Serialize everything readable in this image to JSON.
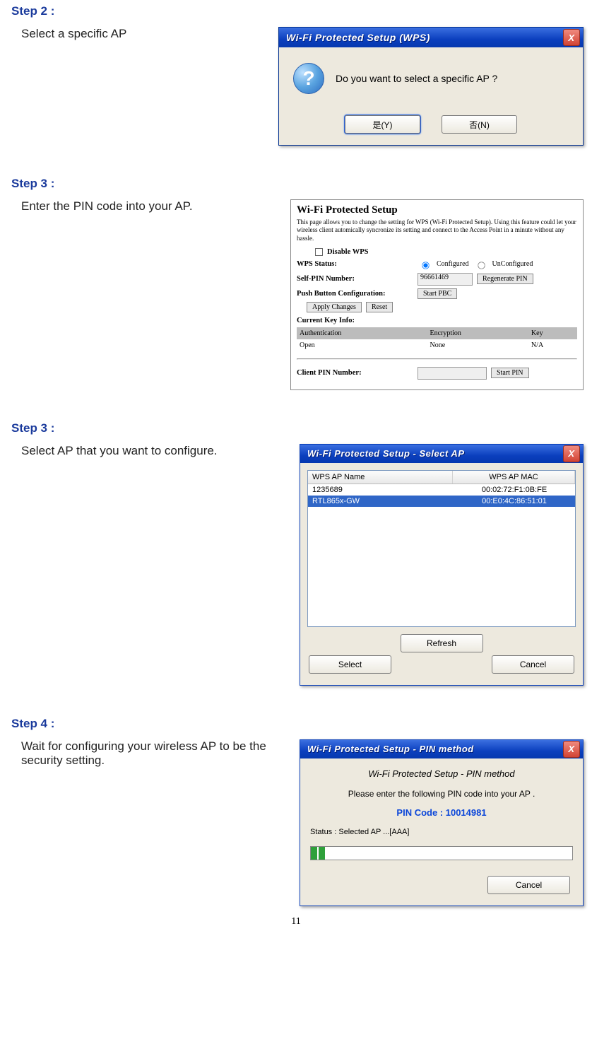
{
  "page_number": "11",
  "steps": {
    "s2": {
      "heading": "Step 2 :",
      "text": "Select a specific AP"
    },
    "s3a": {
      "heading": "Step 3 :",
      "text": "Enter the PIN code into your AP."
    },
    "s3b": {
      "heading": "Step 3 :",
      "text": "Select AP that you want to configure."
    },
    "s4": {
      "heading": "Step 4 :",
      "text": "Wait for configuring your wireless AP to be the security setting."
    }
  },
  "dlg_msgbox": {
    "title": "Wi-Fi Protected Setup (WPS)",
    "close_icon": "X",
    "question_icon": "?",
    "message": "Do you want to select a specific AP ?",
    "btn_yes": "是(Y)",
    "btn_no": "否(N)"
  },
  "dlg_webap": {
    "title": "Wi-Fi Protected Setup",
    "desc": "This page allows you to change the setting for WPS (Wi-Fi Protected Setup). Using this feature could let your wireless client automically syncronize its setting and connect to the Access Point in a minute without any hassle.",
    "disable_wps_label": "Disable WPS",
    "row_status_label": "WPS Status:",
    "row_status_opt1": "Configured",
    "row_status_opt2": "UnConfigured",
    "row_selfpin_label": "Self-PIN Number:",
    "row_selfpin_value": "96661469",
    "btn_regenerate": "Regenerate PIN",
    "row_pbc_label": "Push Button Configuration:",
    "btn_startpbc": "Start PBC",
    "btn_apply": "Apply Changes",
    "btn_reset": "Reset",
    "keyinfo_heading": "Current Key Info:",
    "tbl_auth": "Authentication",
    "tbl_enc": "Encryption",
    "tbl_key": "Key",
    "tbl_auth_val": "Open",
    "tbl_enc_val": "None",
    "tbl_key_val": "N/A",
    "row_clientpin_label": "Client PIN Number:",
    "btn_startpin": "Start PIN"
  },
  "dlg_selap": {
    "title": "Wi-Fi Protected Setup - Select AP",
    "close_icon": "X",
    "col_name": "WPS AP Name",
    "col_mac": "WPS AP MAC",
    "row1_name": "1235689",
    "row1_mac": "00:02:72:F1:0B:FE",
    "row2_name": "RTL865x-GW",
    "row2_mac": "00:E0:4C:86:51:01",
    "btn_refresh": "Refresh",
    "btn_select": "Select",
    "btn_cancel": "Cancel"
  },
  "dlg_pin": {
    "title": "Wi-Fi Protected Setup - PIN method",
    "close_icon": "X",
    "subtitle": "Wi-Fi Protected Setup - PIN method",
    "please": "Please enter the following PIN code into your AP .",
    "pin_label": "PIN Code :  10014981",
    "status": "Status :  Selected AP ...[AAA]",
    "btn_cancel": "Cancel"
  }
}
